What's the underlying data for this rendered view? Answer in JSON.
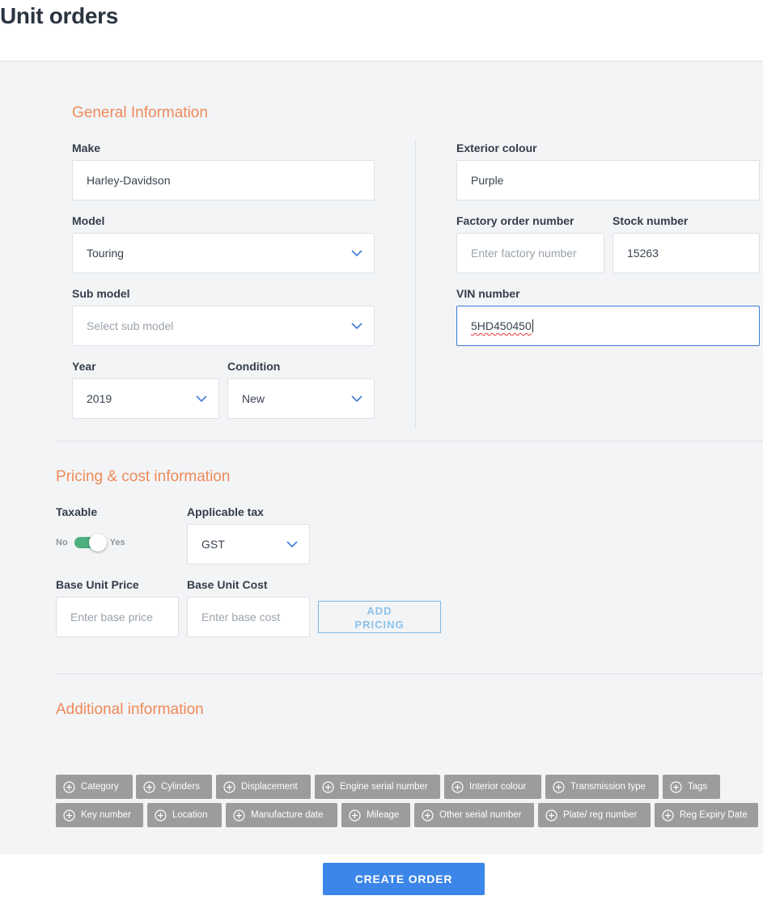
{
  "page": {
    "title": "Unit orders"
  },
  "general": {
    "title": "General Information",
    "make": {
      "label": "Make",
      "value": "Harley-Davidson"
    },
    "model": {
      "label": "Model",
      "value": "Touring"
    },
    "sub_model": {
      "label": "Sub model",
      "placeholder": "Select sub model"
    },
    "year": {
      "label": "Year",
      "value": "2019"
    },
    "condition": {
      "label": "Condition",
      "value": "New"
    },
    "exterior_colour": {
      "label": "Exterior colour",
      "value": "Purple"
    },
    "factory_order": {
      "label": "Factory order number",
      "placeholder": "Enter factory number"
    },
    "stock_number": {
      "label": "Stock number",
      "value": "15263"
    },
    "vin": {
      "label": "VIN number",
      "value": "5HD450450"
    }
  },
  "pricing": {
    "title": "Pricing & cost information",
    "taxable": {
      "label": "Taxable",
      "off_label": "No",
      "on_label": "Yes",
      "checked": true
    },
    "applicable_tax": {
      "label": "Applicable tax",
      "value": "GST"
    },
    "base_unit_price": {
      "label": "Base Unit Price",
      "placeholder": "Enter base price"
    },
    "base_unit_cost": {
      "label": "Base Unit Cost",
      "placeholder": "Enter base cost"
    },
    "add_pricing_line1": "ADD",
    "add_pricing_line2": "PRICING"
  },
  "additional": {
    "title": "Additional information",
    "chips": [
      "Category",
      "Cylinders",
      "Displacement",
      "Engine serial number",
      "Interior colour",
      "Transmission type",
      "Tags",
      "Key number",
      "Location",
      "Manufacture date",
      "Mileage",
      "Other serial number",
      "Plate/ reg number",
      "Reg Expiry Date"
    ]
  },
  "footer": {
    "create_order_label": "CREATE ORDER"
  },
  "colors": {
    "accent": "#ee8a5a",
    "primary": "#3b86e8",
    "toggle_on": "#4caf7d",
    "chip_bg": "#9c9c9c"
  },
  "icons": {
    "dropdown": "chevron-down-icon",
    "chip": "plus-circle-icon"
  }
}
